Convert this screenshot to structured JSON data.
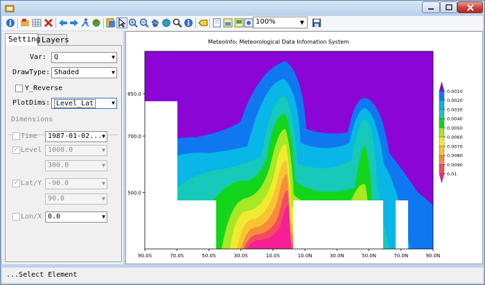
{
  "window": {
    "title": ""
  },
  "toolbar": {
    "zoom_value": "100%"
  },
  "tabs": [
    {
      "label": "Setting"
    },
    {
      "label": "Layers"
    }
  ],
  "setting": {
    "var_label": "Var:",
    "var_value": "Q",
    "drawtype_label": "DrawType:",
    "drawtype_value": "Shaded",
    "y_reverse_label": "Y_Reverse",
    "plotdims_label": "PlotDims:",
    "plotdims_value": "Level_Lat",
    "dimensions_label": "Dimensions",
    "time_label": "Time",
    "time_value": "1987-01-02...",
    "level_label": "Level",
    "level_value": "1000.0",
    "level_value2": "300.0",
    "lat_label": "Lat/Y",
    "lat_value": "-90.0",
    "lat_value2": "90.0",
    "lon_label": "Lon/X",
    "lon_value": "0.0"
  },
  "status": {
    "text": "...Select Element"
  },
  "chart_data": {
    "type": "heatmap",
    "title": "MeteoInfo: Meteorological Data Infomation System",
    "x_ticks": [
      "90.0S",
      "70.0S",
      "50.0S",
      "30.0S",
      "10.0S",
      "10.0N",
      "30.0N",
      "50.0N",
      "70.0N",
      "90.0N"
    ],
    "y_ticks": [
      "500.0",
      "700.0",
      "850.0"
    ],
    "xlim": [
      -90,
      90
    ],
    "ylim": [
      1000,
      300
    ],
    "legend_levels": [
      "0.0010",
      "0.0020",
      "0.0030",
      "0.0040",
      "0.0050",
      "0.0060",
      "0.0070",
      "0.0080",
      "0.0090",
      "0.01"
    ],
    "legend_colors": [
      "#8a05d6",
      "#0f78f0",
      "#08b6e8",
      "#16c9b8",
      "#13d61c",
      "#a8e825",
      "#f1eb2f",
      "#f8c532",
      "#f88c3a",
      "#f34b66",
      "#f71f94"
    ],
    "legend_placement": "right"
  }
}
